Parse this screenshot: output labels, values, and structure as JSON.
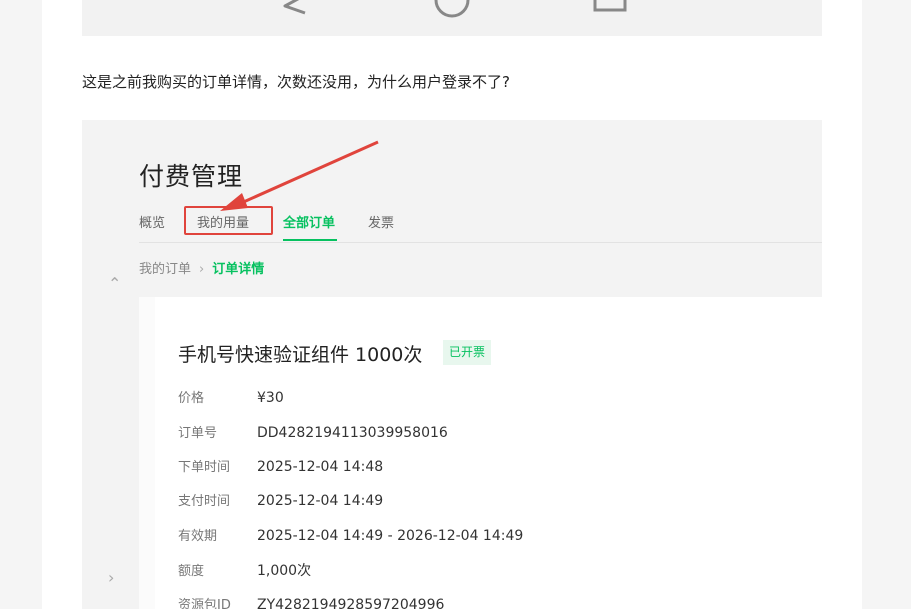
{
  "post": {
    "question": "这是之前我购买的订单详情，次数还没用，为什么用户登录不了?"
  },
  "top_image": {
    "icons": [
      "back-triangle-icon",
      "home-circle-icon",
      "recents-square-icon"
    ]
  },
  "console": {
    "page_title": "付费管理",
    "tabs": [
      {
        "label": "概览"
      },
      {
        "label": "我的用量"
      },
      {
        "label": "全部订单"
      },
      {
        "label": "发票"
      }
    ],
    "active_tab": "全部订单",
    "highlighted_tab": "我的用量",
    "breadcrumb": [
      {
        "label": "我的订单"
      },
      {
        "label": "订单详情"
      }
    ],
    "order": {
      "product_title": "手机号快速验证组件 1000次",
      "status": "已开票",
      "fields": [
        {
          "label": "价格",
          "value": "¥30"
        },
        {
          "label": "订单号",
          "value": "DD4282194113039958016"
        },
        {
          "label": "下单时间",
          "value": "2025-12-04 14:48"
        },
        {
          "label": "支付时间",
          "value": "2025-12-04 14:49"
        },
        {
          "label": "有效期",
          "value": "2025-12-04 14:49 - 2026-12-04 14:49"
        },
        {
          "label": "额度",
          "value": "1,000次"
        },
        {
          "label": "资源包ID",
          "value": "ZY4282194928597204996"
        }
      ]
    }
  },
  "colors": {
    "accent": "#07c160",
    "annotation": "#e0443c"
  }
}
